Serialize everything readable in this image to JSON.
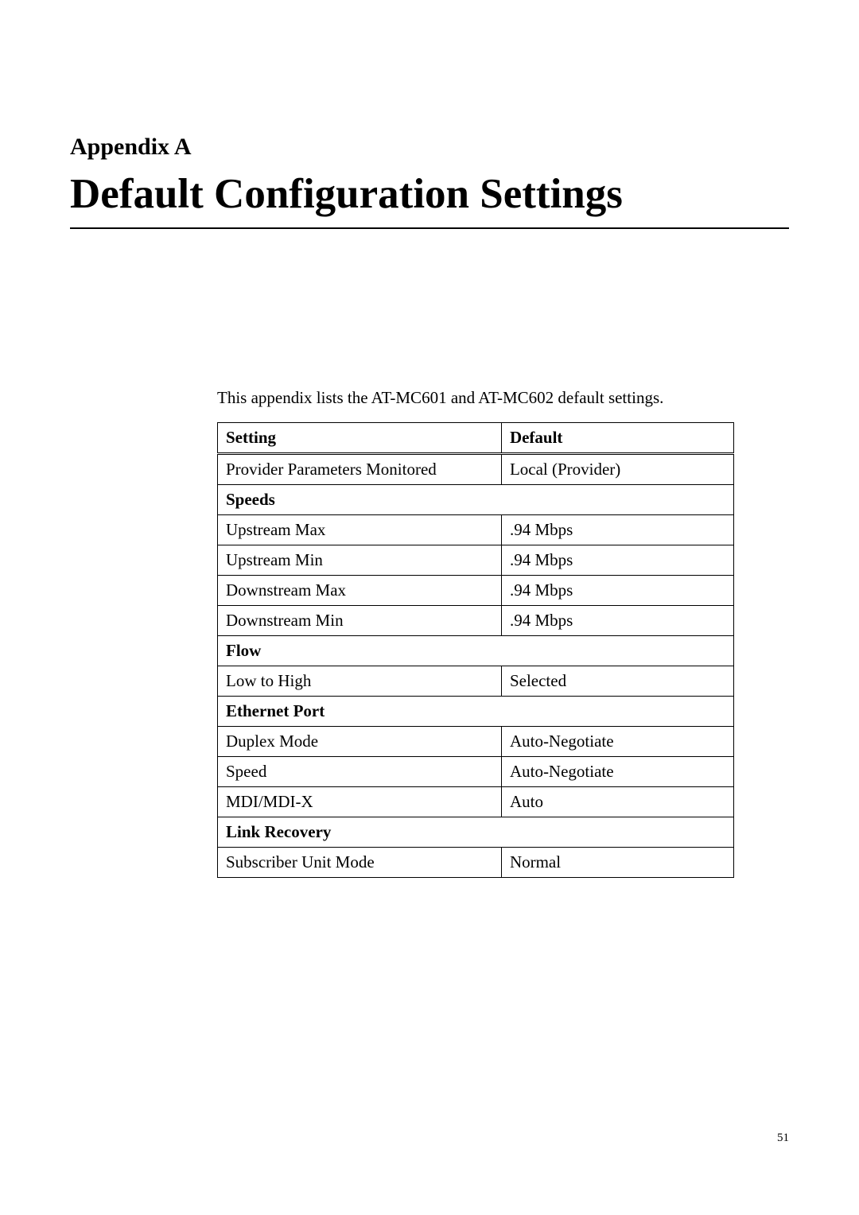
{
  "appendix_label": "Appendix A",
  "main_title": "Default Configuration Settings",
  "intro_text": "This appendix lists the AT-MC601 and AT-MC602 default settings.",
  "table": {
    "header_setting": "Setting",
    "header_default": "Default",
    "row1_setting": "Provider Parameters Monitored",
    "row1_default": "Local (Provider)",
    "section_speeds": "Speeds",
    "row2_setting": "Upstream Max",
    "row2_default": ".94 Mbps",
    "row3_setting": "Upstream Min",
    "row3_default": ".94 Mbps",
    "row4_setting": "Downstream Max",
    "row4_default": ".94 Mbps",
    "row5_setting": "Downstream Min",
    "row5_default": ".94 Mbps",
    "section_flow": "Flow",
    "row6_setting": "Low to High",
    "row6_default": "Selected",
    "section_ethernet": "Ethernet Port",
    "row7_setting": "Duplex Mode",
    "row7_default": "Auto-Negotiate",
    "row8_setting": "Speed",
    "row8_default": "Auto-Negotiate",
    "row9_setting": "MDI/MDI-X",
    "row9_default": "Auto",
    "section_link": "Link Recovery",
    "row10_setting": "Subscriber Unit Mode",
    "row10_default": "Normal"
  },
  "page_number": "51"
}
